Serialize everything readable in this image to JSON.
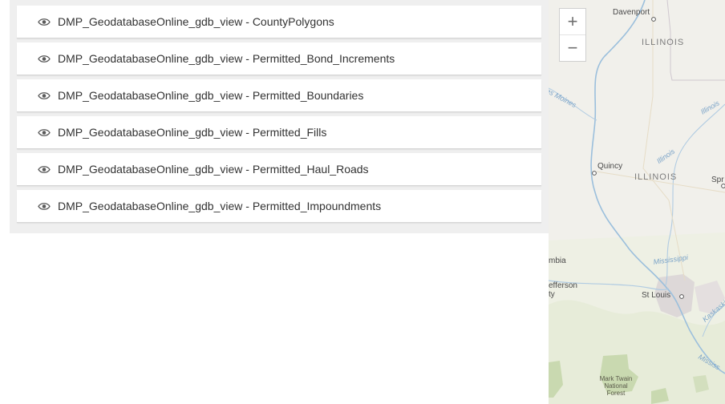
{
  "layers": [
    {
      "label": "DMP_GeodatabaseOnline_gdb_view - CountyPolygons",
      "icon": "eye-icon"
    },
    {
      "label": "DMP_GeodatabaseOnline_gdb_view - Permitted_Bond_Increments",
      "icon": "eye-icon"
    },
    {
      "label": "DMP_GeodatabaseOnline_gdb_view - Permitted_Boundaries",
      "icon": "eye-icon"
    },
    {
      "label": "DMP_GeodatabaseOnline_gdb_view - Permitted_Fills",
      "icon": "eye-icon"
    },
    {
      "label": "DMP_GeodatabaseOnline_gdb_view - Permitted_Haul_Roads",
      "icon": "eye-icon"
    },
    {
      "label": "DMP_GeodatabaseOnline_gdb_view - Permitted_Impoundments",
      "icon": "eye-icon"
    }
  ],
  "map": {
    "zoom_in": "+",
    "zoom_out": "−",
    "labels": {
      "davenport": "Davenport",
      "illinois_top": "ILLINOIS",
      "des_moines": "es Moines",
      "illinois_river_1": "Illinois",
      "quincy": "Quincy",
      "illinois_river_2": "Illinois",
      "illinois_mid": "ILLINOIS",
      "springfield": "Spr",
      "columbia": "mbia",
      "jefferson": "efferson",
      "jefferson_2": "ty",
      "mississippi_1": "Mississippi",
      "st_louis": "St Louis",
      "kaskaskia": "Kaskaskia",
      "mississippi_2": "Mississ",
      "forest_1": "Mark Twain",
      "forest_2": "National",
      "forest_3": "Forest"
    }
  },
  "colors": {
    "panel_bg": "#efefef",
    "map_bg": "#f1f0eb",
    "river": "#9bbfdc",
    "forest": "#c9d9b0"
  }
}
